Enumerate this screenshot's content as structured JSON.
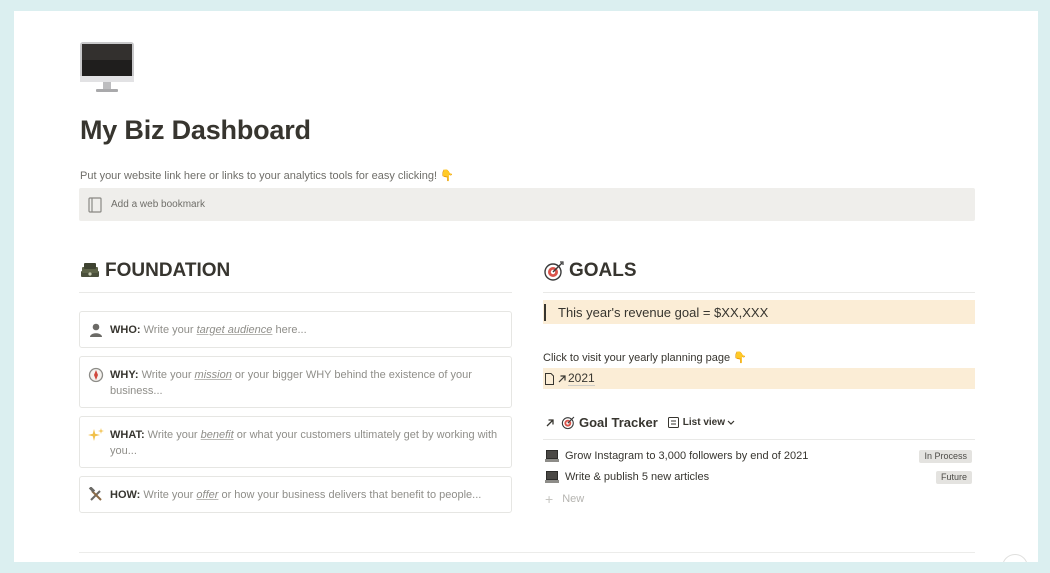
{
  "page": {
    "icon": "desktop-computer-icon",
    "title": "My Biz Dashboard",
    "subtitle": "Put your website link here or links to your analytics tools for easy clicking! 👇",
    "bookmark_placeholder": "Add a web bookmark"
  },
  "foundation": {
    "heading": "FOUNDATION",
    "icon": "money-stack-icon",
    "cards": [
      {
        "icon": "bust-silhouette-icon",
        "label": "WHO:",
        "pre": " Write your ",
        "em": "target audience",
        "post": " here..."
      },
      {
        "icon": "compass-icon",
        "label": "WHY:",
        "pre": " Write your ",
        "em": "mission",
        "post": " or your bigger WHY behind the existence of your business..."
      },
      {
        "icon": "sparkles-icon",
        "label": "WHAT:",
        "pre": " Write your ",
        "em": "benefit",
        "post": " or what your customers ultimately get by working with you..."
      },
      {
        "icon": "hammer-wrench-icon",
        "label": "HOW:",
        "pre": " Write your ",
        "em": "offer",
        "post": " or how your business delivers that benefit to people..."
      }
    ]
  },
  "goals": {
    "heading": "GOALS",
    "icon": "bullseye-icon",
    "revenue_callout": "This year's revenue goal = $XX,XXX",
    "planning_text": "Click to visit your yearly planning page 👇",
    "planning_link": "2021",
    "tracker": {
      "title": "Goal Tracker",
      "view_label": "List view",
      "rows": [
        {
          "icon": "laptop-icon",
          "text": "Grow Instagram to 3,000 followers by end of 2021",
          "status": "In Process"
        },
        {
          "icon": "laptop-icon",
          "text": "Write & publish 5 new articles",
          "status": "Future"
        }
      ],
      "new_label": "New"
    }
  },
  "colors": {
    "callout_bg": "#fbedd6",
    "bookmark_bg": "#efeeeb",
    "frame_bg": "#dbeff0"
  }
}
